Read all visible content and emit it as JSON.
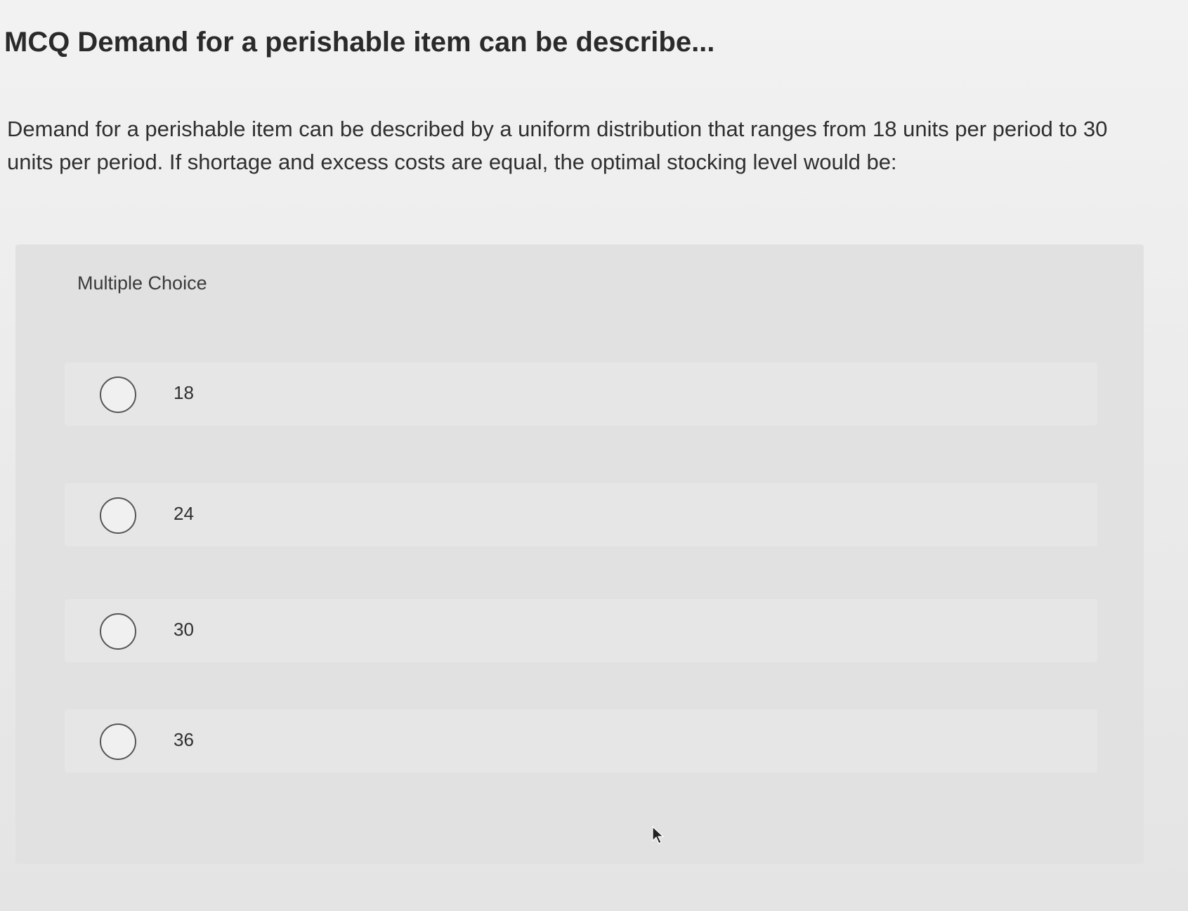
{
  "title": "MCQ Demand for a perishable item can be describe...",
  "question": "Demand for a perishable item can be described by a uniform distribution that ranges from 18 units per period to 30 units per period. If shortage and excess costs are equal, the optimal stocking level would be:",
  "multiple_choice": {
    "header": "Multiple Choice",
    "options": [
      {
        "label": "18"
      },
      {
        "label": "24"
      },
      {
        "label": "30"
      },
      {
        "label": "36"
      }
    ]
  },
  "icons": {
    "radio": "radio-unselected-icon",
    "cursor": "mouse-pointer-icon"
  }
}
